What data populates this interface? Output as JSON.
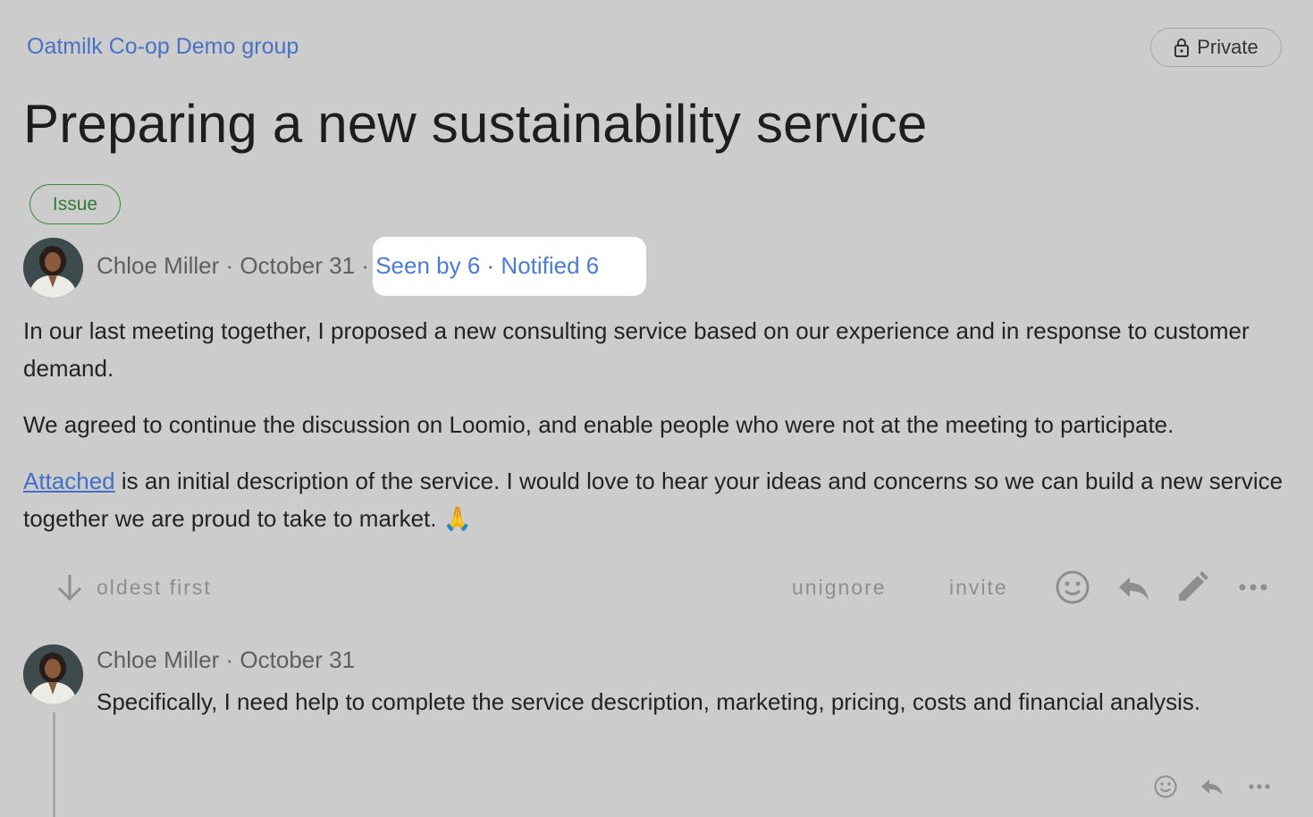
{
  "header": {
    "group_name": "Oatmilk Co-op Demo group",
    "privacy_label": "Private"
  },
  "discussion": {
    "title": "Preparing a new sustainability service",
    "tag": "Issue",
    "author": "Chloe Miller",
    "separator": "·",
    "date": "October 31",
    "seen_by": "Seen by 6",
    "notified": "Notified 6",
    "paragraphs": [
      "In our last meeting together, I proposed a new consulting service based on our experience and in response to customer demand.",
      "We agreed to continue the discussion on Loomio, and enable people who were not at the meeting to participate."
    ],
    "p3_link": "Attached",
    "p3_rest": " is an initial description of the service. I would love to hear your ideas and concerns so we can build a new service together we are proud to take to market. ",
    "p3_emoji": "🙏"
  },
  "actions": {
    "sort_label": "oldest first",
    "unignore_label": "unignore",
    "invite_label": "invite"
  },
  "comment": {
    "author": "Chloe Miller",
    "separator": "·",
    "date": "October 31",
    "text": "Specifically, I need help to complete the service description, marketing, pricing, costs and financial analysis."
  }
}
